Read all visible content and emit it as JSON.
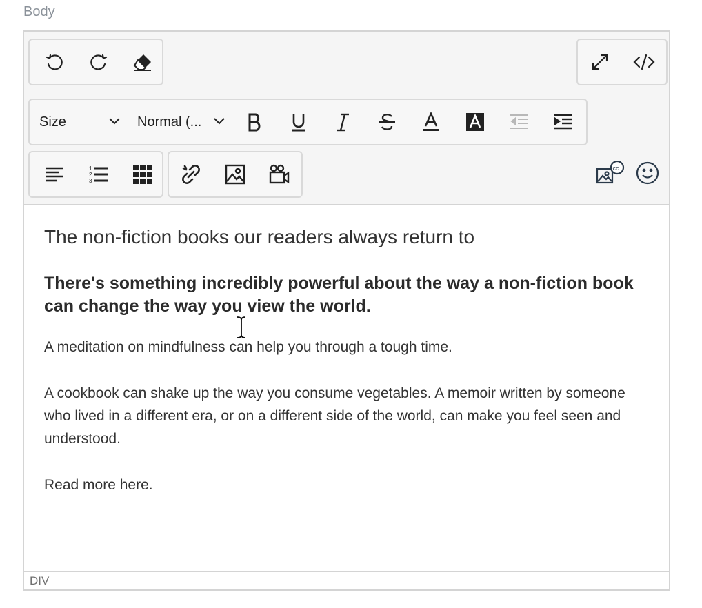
{
  "field_label": "Body",
  "toolbar": {
    "history": [
      "undo-icon",
      "redo-icon",
      "eraser-icon"
    ],
    "view": [
      "fullscreen-icon",
      "code-view-icon"
    ],
    "size_select": "Size",
    "block_select": "Normal (...",
    "format": [
      "bold-icon",
      "underline-icon",
      "italic-icon",
      "strikethrough-icon",
      "font-color-icon",
      "highlight-color-icon",
      "outdent-icon",
      "indent-icon"
    ],
    "paragraph": [
      "align-left-icon",
      "ordered-list-icon",
      "table-icon"
    ],
    "insert": [
      "link-icon",
      "image-icon",
      "video-icon"
    ],
    "extras": [
      "image-cc-icon",
      "emoji-icon"
    ]
  },
  "content": {
    "heading": "The non-fiction books our readers always return to",
    "bold_paragraph": "There's something incredibly powerful about the way a non-fiction book can change the way you view the world.",
    "paragraphs": [
      "A meditation on mindfulness can help you through a tough time.",
      "A cookbook can shake up the way you consume vegetables. A memoir written by someone who lived in a different era, or on a different side of the world, can make you feel seen and understood.",
      "Read more here."
    ]
  },
  "status": {
    "element_path": "DIV"
  }
}
